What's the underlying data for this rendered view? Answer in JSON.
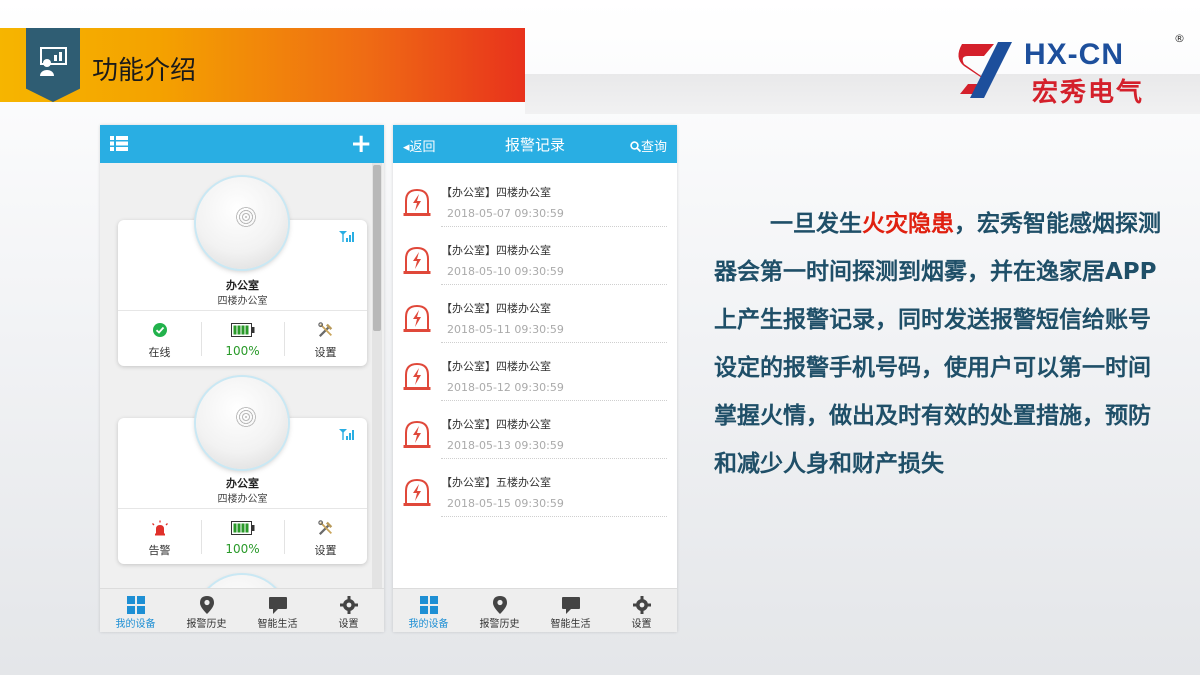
{
  "banner": {
    "title": "功能介绍"
  },
  "logo": {
    "en": "HX-CN",
    "cn": "宏秀电气",
    "reg": "®"
  },
  "colors": {
    "accent": "#29aee3",
    "highlight": "#e02010",
    "text": "#1f4f68"
  },
  "phone1": {
    "topbar": {
      "menu_icon": "list-icon",
      "plus": "+"
    },
    "cards": [
      {
        "name": "办公室",
        "sub": "四楼办公室",
        "status": "在线",
        "status_icon": "check-circle-icon",
        "battery": "100%",
        "settings": "设置"
      },
      {
        "name": "办公室",
        "sub": "四楼办公室",
        "status": "告警",
        "status_icon": "alarm-icon",
        "battery": "100%",
        "settings": "设置"
      }
    ]
  },
  "tabs": [
    {
      "label": "我的设备",
      "icon": "grid-icon"
    },
    {
      "label": "报警历史",
      "icon": "location-pin-icon"
    },
    {
      "label": "智能生活",
      "icon": "chat-icon"
    },
    {
      "label": "设置",
      "icon": "gear-icon"
    }
  ],
  "phone2": {
    "back": "返回",
    "title": "报警记录",
    "query": "查询",
    "records": [
      {
        "title": "【办公室】四楼办公室",
        "date": "2018-05-07 09:30:59"
      },
      {
        "title": "【办公室】四楼办公室",
        "date": "2018-05-10 09:30:59"
      },
      {
        "title": "【办公室】四楼办公室",
        "date": "2018-05-11 09:30:59"
      },
      {
        "title": "【办公室】四楼办公室",
        "date": "2018-05-12 09:30:59"
      },
      {
        "title": "【办公室】四楼办公室",
        "date": "2018-05-13 09:30:59"
      },
      {
        "title": "【办公室】五楼办公室",
        "date": "2018-05-15 09:30:59"
      }
    ]
  },
  "description": {
    "pre": "一旦发生",
    "highlight": "火灾隐患",
    "post": "，宏秀智能感烟探测器会第一时间探测到烟雾，并在逸家居APP上产生报警记录，同时发送报警短信给账号设定的报警手机号码，使用户可以第一时间掌握火情，做出及时有效的处置措施，预防和减少人身和财产损失"
  }
}
